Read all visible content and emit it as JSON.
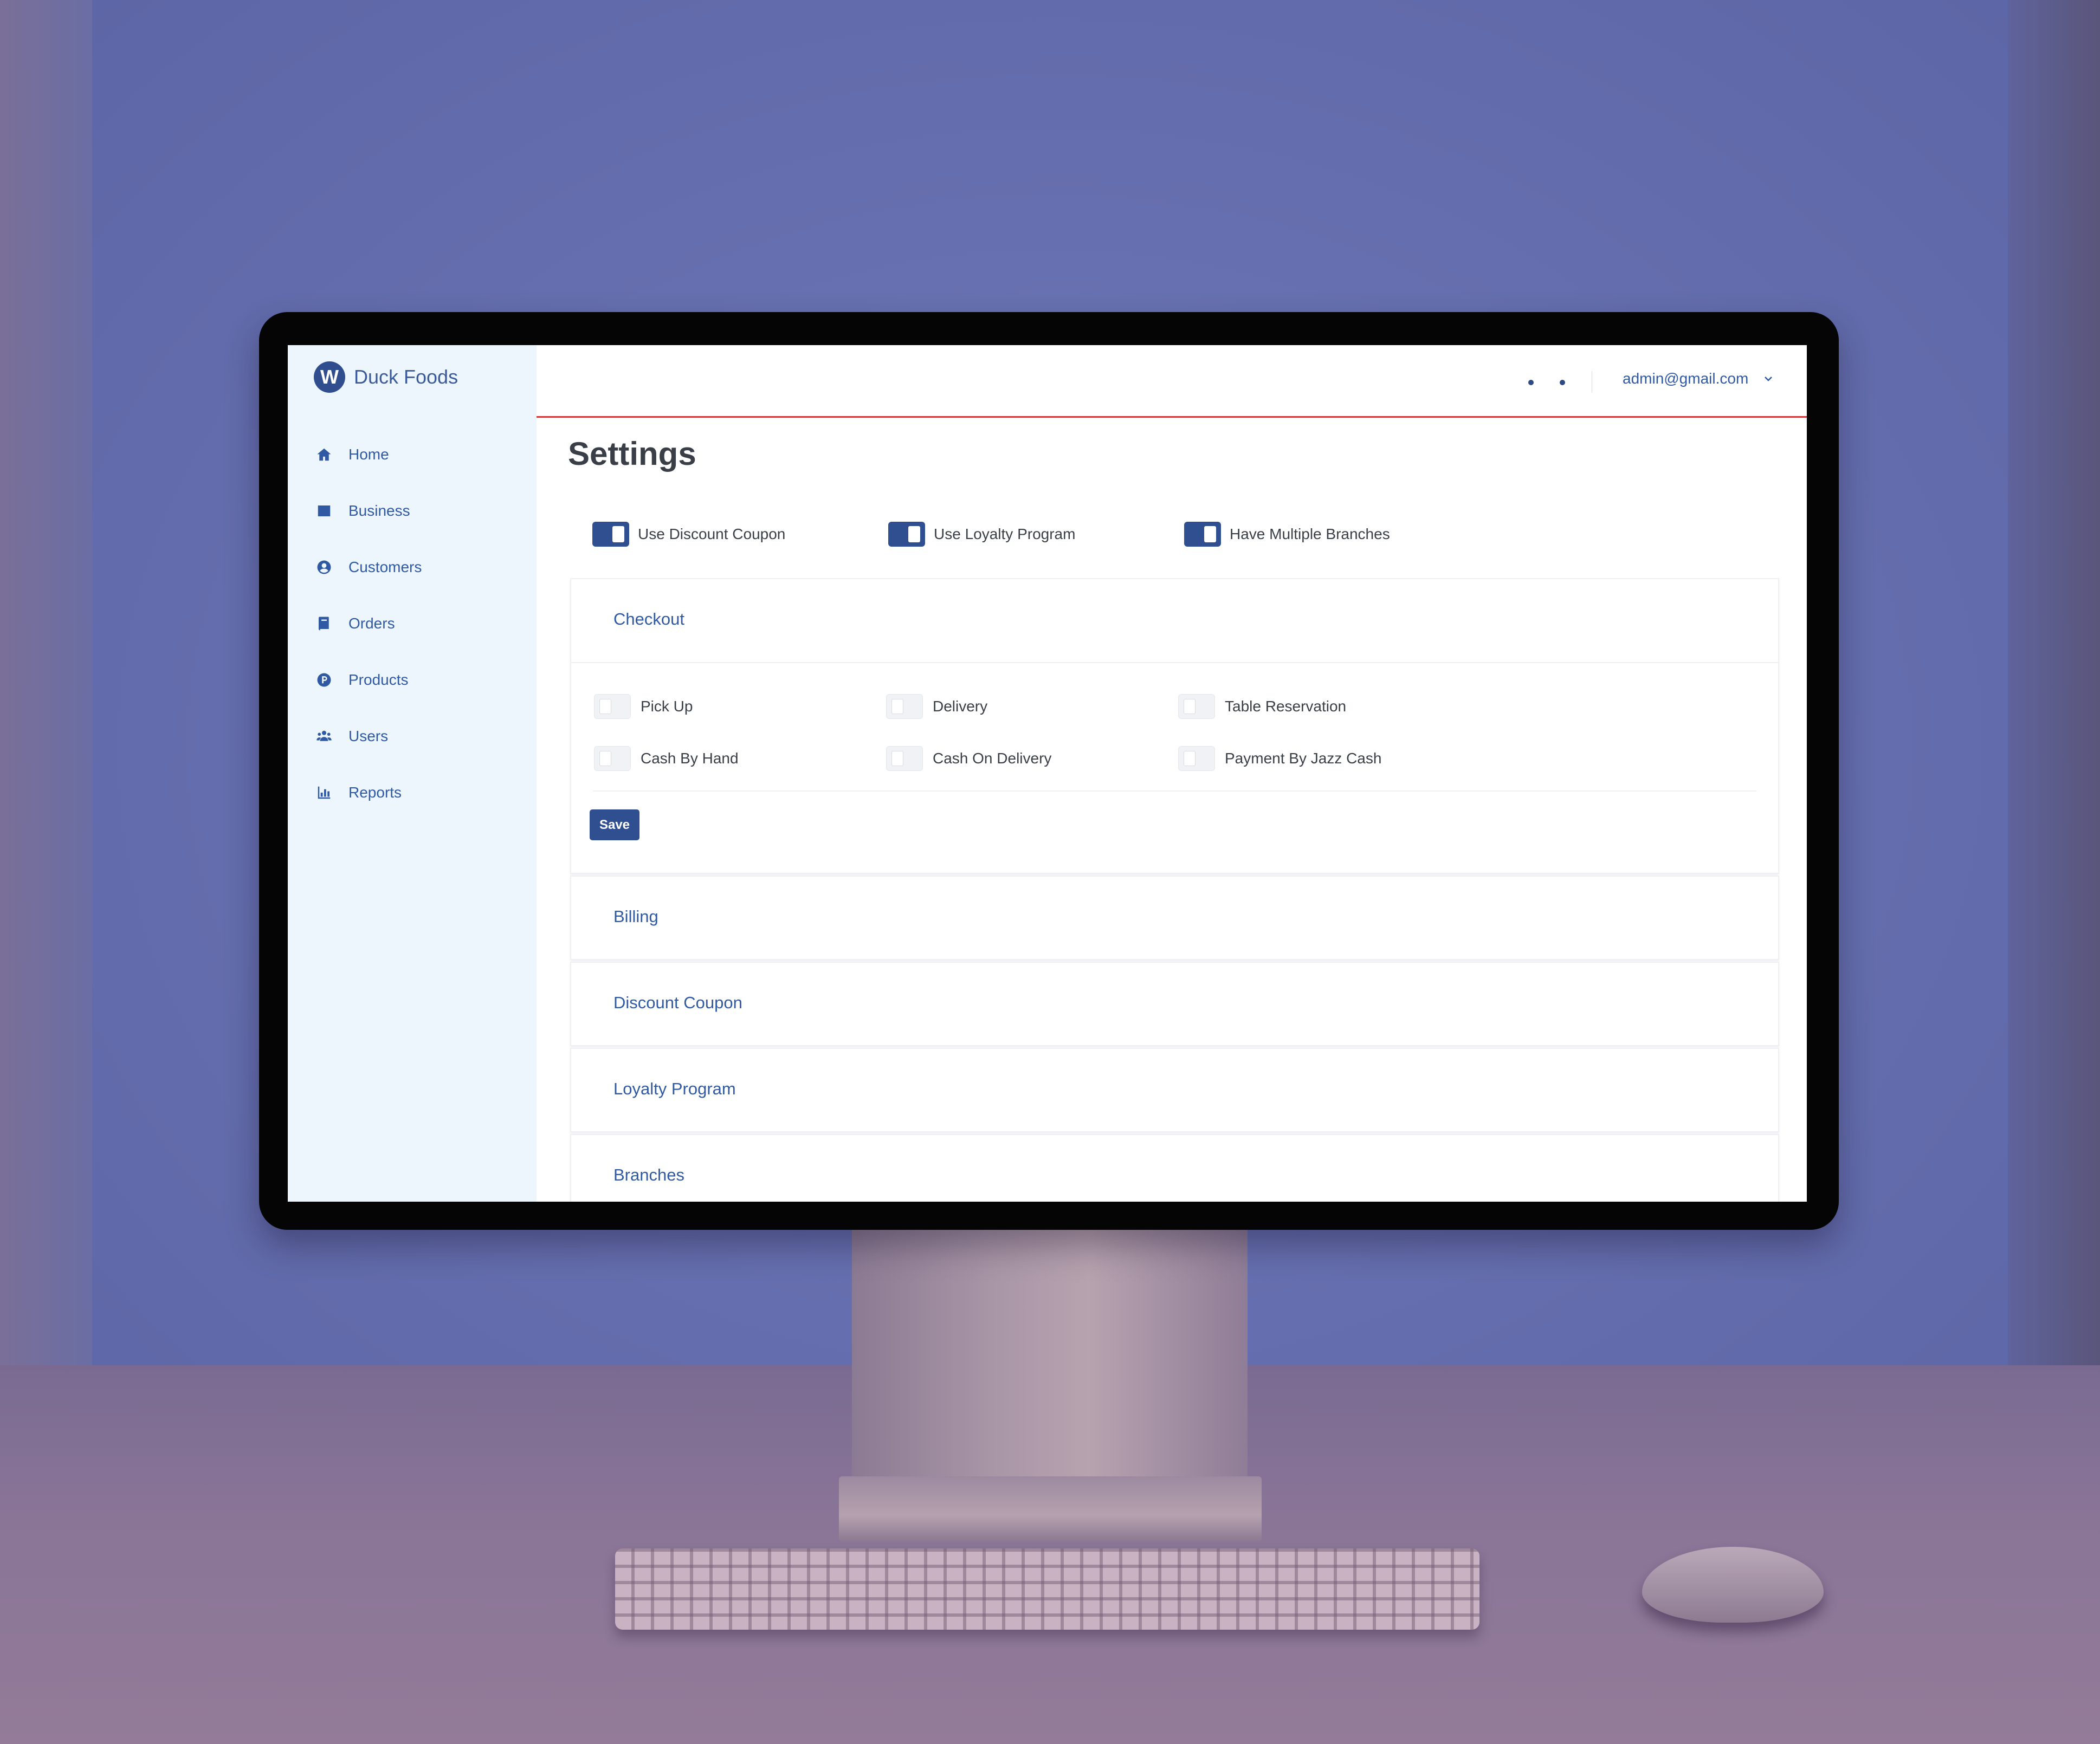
{
  "brand": {
    "logo_letter": "W",
    "name": "Duck Foods"
  },
  "sidebar": {
    "items": [
      {
        "label": "Home",
        "icon": "home-icon"
      },
      {
        "label": "Business",
        "icon": "table-icon"
      },
      {
        "label": "Customers",
        "icon": "user-circle-icon"
      },
      {
        "label": "Orders",
        "icon": "book-icon"
      },
      {
        "label": "Products",
        "icon": "product-p-icon"
      },
      {
        "label": "Users",
        "icon": "users-icon"
      },
      {
        "label": "Reports",
        "icon": "bar-chart-icon"
      }
    ]
  },
  "header": {
    "user_email": "admin@gmail.com"
  },
  "main": {
    "title": "Settings",
    "feature_toggles": [
      {
        "label": "Use Discount Coupon",
        "on": true
      },
      {
        "label": "Use Loyalty Program",
        "on": true
      },
      {
        "label": "Have Multiple Branches",
        "on": true
      }
    ],
    "checkout": {
      "title": "Checkout",
      "options": [
        {
          "label": "Pick Up",
          "on": false
        },
        {
          "label": "Delivery",
          "on": false
        },
        {
          "label": "Table Reservation",
          "on": false
        },
        {
          "label": "Cash By Hand",
          "on": false
        },
        {
          "label": "Cash On Delivery",
          "on": false
        },
        {
          "label": "Payment By Jazz Cash",
          "on": false
        }
      ],
      "save_label": "Save"
    },
    "sections": [
      {
        "title": "Billing"
      },
      {
        "title": "Discount Coupon"
      },
      {
        "title": "Loyalty Program"
      },
      {
        "title": "Branches"
      }
    ]
  },
  "colors": {
    "primary": "#2f4f90",
    "link": "#2f5aa3",
    "header_rule": "#d03a3a",
    "sidebar_bg": "#eef6fd"
  }
}
